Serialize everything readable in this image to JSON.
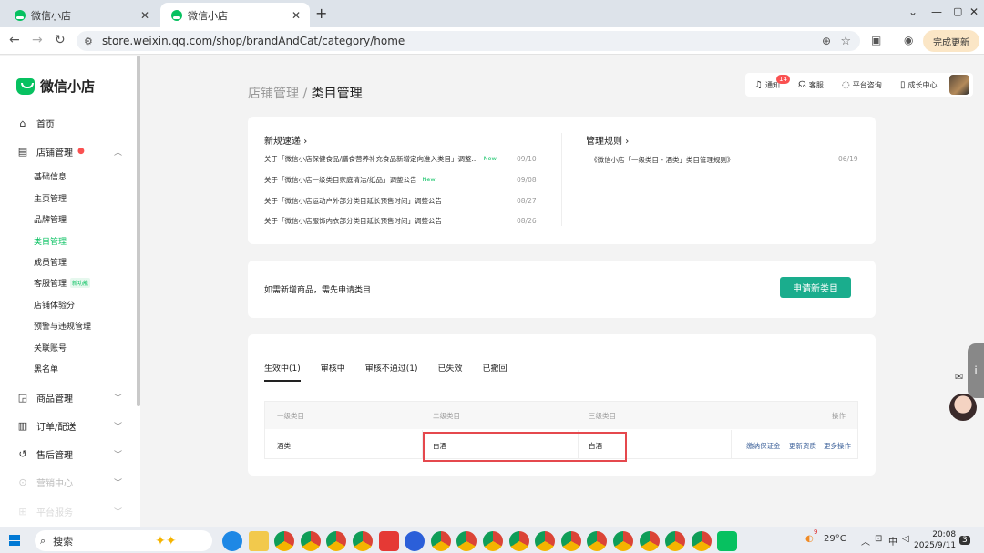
{
  "browser": {
    "tabs": [
      {
        "title": "微信小店",
        "active": false
      },
      {
        "title": "微信小店",
        "active": true
      }
    ],
    "new_tab": "+",
    "window_controls": {
      "minimize": "—",
      "maximize": "▢",
      "close": "✕",
      "chevron": "⌄"
    },
    "url": "store.weixin.qq.com/shop/brandAndCat/category/home",
    "update_button": "完成更新",
    "tab_close": "✕"
  },
  "sidebar": {
    "logo": "微信小店",
    "home": "首页",
    "shop_manage": "店铺管理",
    "shop_sub": [
      "基础信息",
      "主页管理",
      "品牌管理",
      "类目管理",
      "成员管理",
      "客服管理",
      "店铺体验分",
      "预警与违规管理",
      "关联账号",
      "黑名单"
    ],
    "new_feature_badge": "新功能",
    "goods": "商品管理",
    "orders": "订单/配送",
    "after_sales": "售后管理",
    "marketing": "营销中心",
    "platform": "平台服务"
  },
  "breadcrumb": {
    "parent": "店铺管理",
    "sep": "/",
    "current": "类目管理"
  },
  "top_actions": {
    "notify": "通知",
    "notify_count": "14",
    "service": "客服",
    "consult": "平台咨询",
    "growth": "成长中心"
  },
  "news": {
    "title": "新规速递",
    "items": [
      {
        "text": "关于「微信小店保健食品/膳食营养补充食品新增定向准入类目」调整...",
        "badge": "New",
        "date": "09/10"
      },
      {
        "text": "关于「微信小店一级类目家庭清洁/纸品」调整公告",
        "badge": "New",
        "date": "09/08"
      },
      {
        "text": "关于「微信小店运动户外部分类目延长预售时间」调整公告",
        "badge": "",
        "date": "08/27"
      },
      {
        "text": "关于「微信小店服饰内衣部分类目延长预售时间」调整公告",
        "badge": "",
        "date": "08/26"
      }
    ]
  },
  "rules": {
    "title": "管理规则",
    "items": [
      {
        "text": "《微信小店「一级类目 - 酒类」类目管理规则》",
        "date": "06/19"
      }
    ]
  },
  "apply": {
    "hint": "如需新增商品，需先申请类目",
    "button": "申请新类目"
  },
  "category_tabs": [
    "生效中(1)",
    "审核中",
    "审核不通过(1)",
    "已失效",
    "已撤回"
  ],
  "table": {
    "headers": [
      "一级类目",
      "二级类目",
      "三级类目",
      "操作"
    ],
    "rows": [
      {
        "level1": "酒类",
        "level2": "白酒",
        "level3": "白酒",
        "ops": [
          "缴纳保证金",
          "更新资质",
          "更多操作"
        ]
      }
    ]
  },
  "taskbar": {
    "search": "搜索",
    "weather": "29°C",
    "weather_badge": "9",
    "time": "20:08",
    "date": "2025/9/11",
    "ime": "中",
    "notifications": "3"
  }
}
